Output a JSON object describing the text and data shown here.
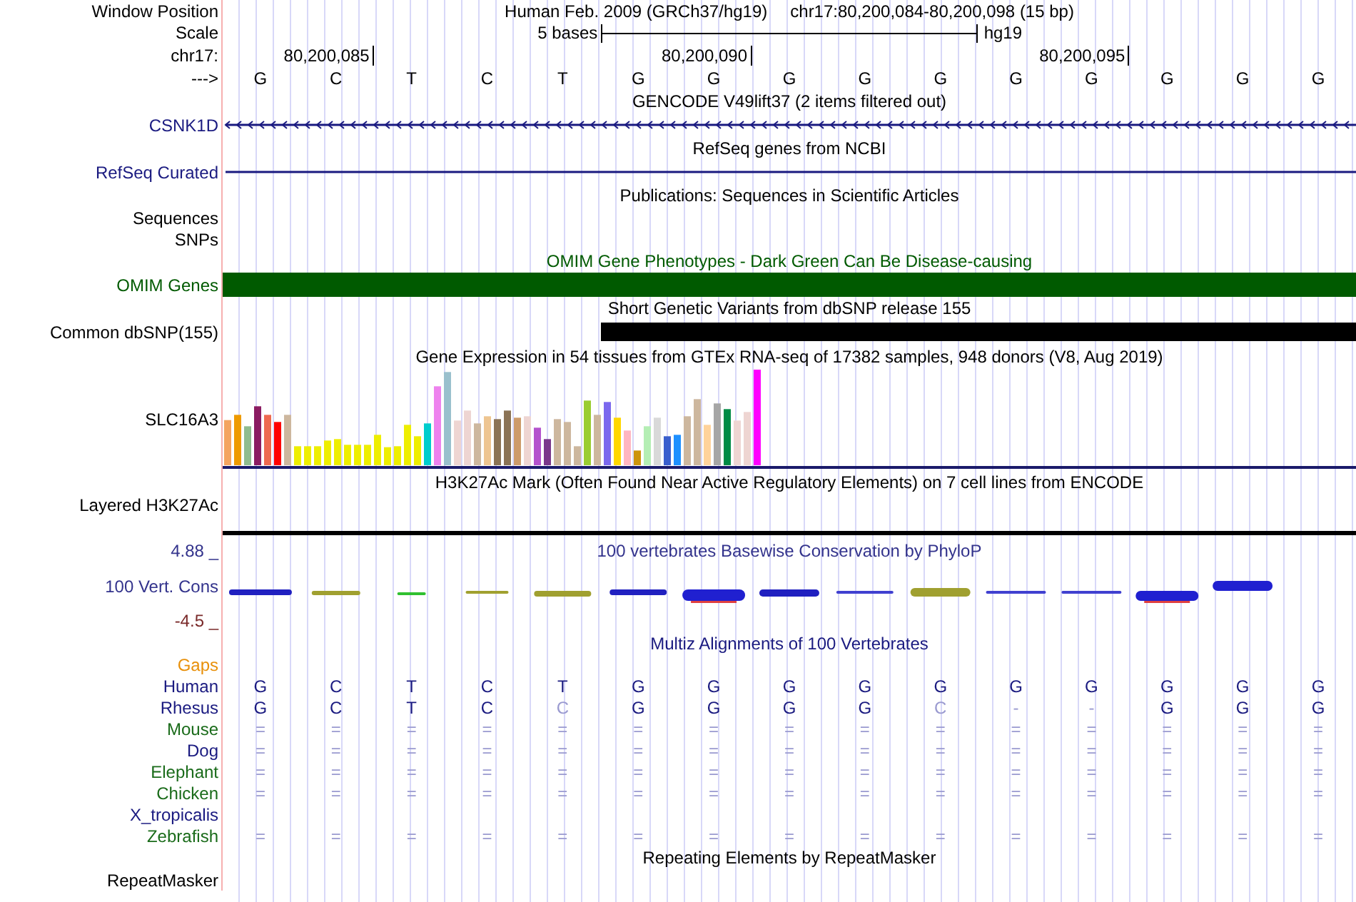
{
  "header": {
    "label": "Window Position",
    "assembly": "Human Feb. 2009 (GRCh37/hg19)",
    "position": "chr17:80,200,084-80,200,098 (15 bp)"
  },
  "scale": {
    "label": "Scale",
    "span": "5 bases",
    "assembly": "hg19"
  },
  "ruler": {
    "label": "chr17:",
    "ticks": [
      "80,200,085",
      "80,200,090",
      "80,200,095"
    ]
  },
  "bases": {
    "label": "--->",
    "letters": [
      "G",
      "C",
      "T",
      "C",
      "T",
      "G",
      "G",
      "G",
      "G",
      "G",
      "G",
      "G",
      "G",
      "G",
      "G"
    ]
  },
  "tracks": [
    {
      "kind": "gene",
      "title": "GENCODE V49lift37 (2 items filtered out)",
      "label": "CSNK1D",
      "color": "#1a1a80",
      "reverse_strand": true
    },
    {
      "kind": "gene",
      "title": "RefSeq genes from NCBI",
      "label": "RefSeq Curated",
      "color": "#1a1a80"
    },
    {
      "kind": "empty",
      "title": "Publications: Sequences in Scientific Articles",
      "label": "Sequences",
      "color": "#000000"
    },
    {
      "kind": "empty",
      "label": "SNPs",
      "color": "#000000"
    },
    {
      "kind": "bar",
      "title": "OMIM Gene Phenotypes - Dark Green Can Be Disease-causing",
      "label": "OMIM Genes",
      "color": "#005a00",
      "starts_in_view": false
    },
    {
      "kind": "bar",
      "title": "Short Genetic Variants from dbSNP release 155",
      "label": "Common dbSNP(155)",
      "color": "#000000",
      "starts_in_view": true
    },
    {
      "kind": "expression",
      "title": "Gene Expression in 54 tissues from GTEx RNA-seq of 17382 samples, 948 donors (V8, Aug 2019)",
      "label": "SLC16A3",
      "color": "#000000"
    },
    {
      "kind": "line",
      "title": "H3K27Ac Mark (Often Found Near Active Regulatory Elements) on 7 cell lines from ENCODE",
      "label": "Layered H3K27Ac",
      "color": "#000000"
    },
    {
      "kind": "conservation",
      "title": "100 vertebrates Basewise Conservation by PhyloP",
      "label": "100 Vert. Cons",
      "max": "4.88 _",
      "min": "-4.5 _",
      "color": "#33338c"
    },
    {
      "kind": "alignment",
      "title": "Multiz Alignments of 100 Vertebrates",
      "gaps_label": "Gaps",
      "color": "#1a1a80",
      "species": [
        {
          "name": "Human",
          "color": "#1a1a80",
          "bases": [
            "G",
            "C",
            "T",
            "C",
            "T",
            "G",
            "G",
            "G",
            "G",
            "G",
            "G",
            "G",
            "G",
            "G",
            "G"
          ],
          "dimmed": [
            false,
            false,
            false,
            false,
            false,
            false,
            false,
            false,
            false,
            false,
            false,
            false,
            false,
            false,
            false
          ]
        },
        {
          "name": "Rhesus",
          "color": "#1a1a80",
          "bases": [
            "G",
            "C",
            "T",
            "C",
            "C",
            "G",
            "G",
            "G",
            "G",
            "C",
            "-",
            "-",
            "G",
            "G",
            "G"
          ],
          "dimmed": [
            false,
            false,
            false,
            false,
            true,
            false,
            false,
            false,
            false,
            true,
            true,
            true,
            false,
            false,
            false
          ]
        },
        {
          "name": "Mouse",
          "color": "#1a6b1a",
          "bases": [
            "=",
            "=",
            "=",
            "=",
            "=",
            "=",
            "=",
            "=",
            "=",
            "=",
            "=",
            "=",
            "=",
            "=",
            "="
          ],
          "dimmed": [
            true,
            true,
            true,
            true,
            true,
            true,
            true,
            true,
            true,
            true,
            true,
            true,
            true,
            true,
            true
          ]
        },
        {
          "name": "Dog",
          "color": "#1a1a80",
          "bases": [
            "=",
            "=",
            "=",
            "=",
            "=",
            "=",
            "=",
            "=",
            "=",
            "=",
            "=",
            "=",
            "=",
            "=",
            "="
          ],
          "dimmed": [
            true,
            true,
            true,
            true,
            true,
            true,
            true,
            true,
            true,
            true,
            true,
            true,
            true,
            true,
            true
          ]
        },
        {
          "name": "Elephant",
          "color": "#1a6b1a",
          "bases": [
            "=",
            "=",
            "=",
            "=",
            "=",
            "=",
            "=",
            "=",
            "=",
            "=",
            "=",
            "=",
            "=",
            "=",
            "="
          ],
          "dimmed": [
            true,
            true,
            true,
            true,
            true,
            true,
            true,
            true,
            true,
            true,
            true,
            true,
            true,
            true,
            true
          ]
        },
        {
          "name": "Chicken",
          "color": "#1a6b1a",
          "bases": [
            "=",
            "=",
            "=",
            "=",
            "=",
            "=",
            "=",
            "=",
            "=",
            "=",
            "=",
            "=",
            "=",
            "=",
            "="
          ],
          "dimmed": [
            true,
            true,
            true,
            true,
            true,
            true,
            true,
            true,
            true,
            true,
            true,
            true,
            true,
            true,
            true
          ]
        },
        {
          "name": "X_tropicalis",
          "color": "#1a1a80"
        },
        {
          "name": "Zebrafish",
          "color": "#1a6b1a",
          "bases": [
            "=",
            "=",
            "=",
            "=",
            "=",
            "=",
            "=",
            "=",
            "=",
            "=",
            "=",
            "=",
            "=",
            "=",
            "="
          ],
          "dimmed": [
            true,
            true,
            true,
            true,
            true,
            true,
            true,
            true,
            true,
            true,
            true,
            true,
            true,
            true,
            true
          ]
        }
      ]
    },
    {
      "kind": "empty",
      "title": "Repeating Elements by RepeatMasker",
      "label": "RepeatMasker",
      "color": "#000000"
    }
  ]
}
